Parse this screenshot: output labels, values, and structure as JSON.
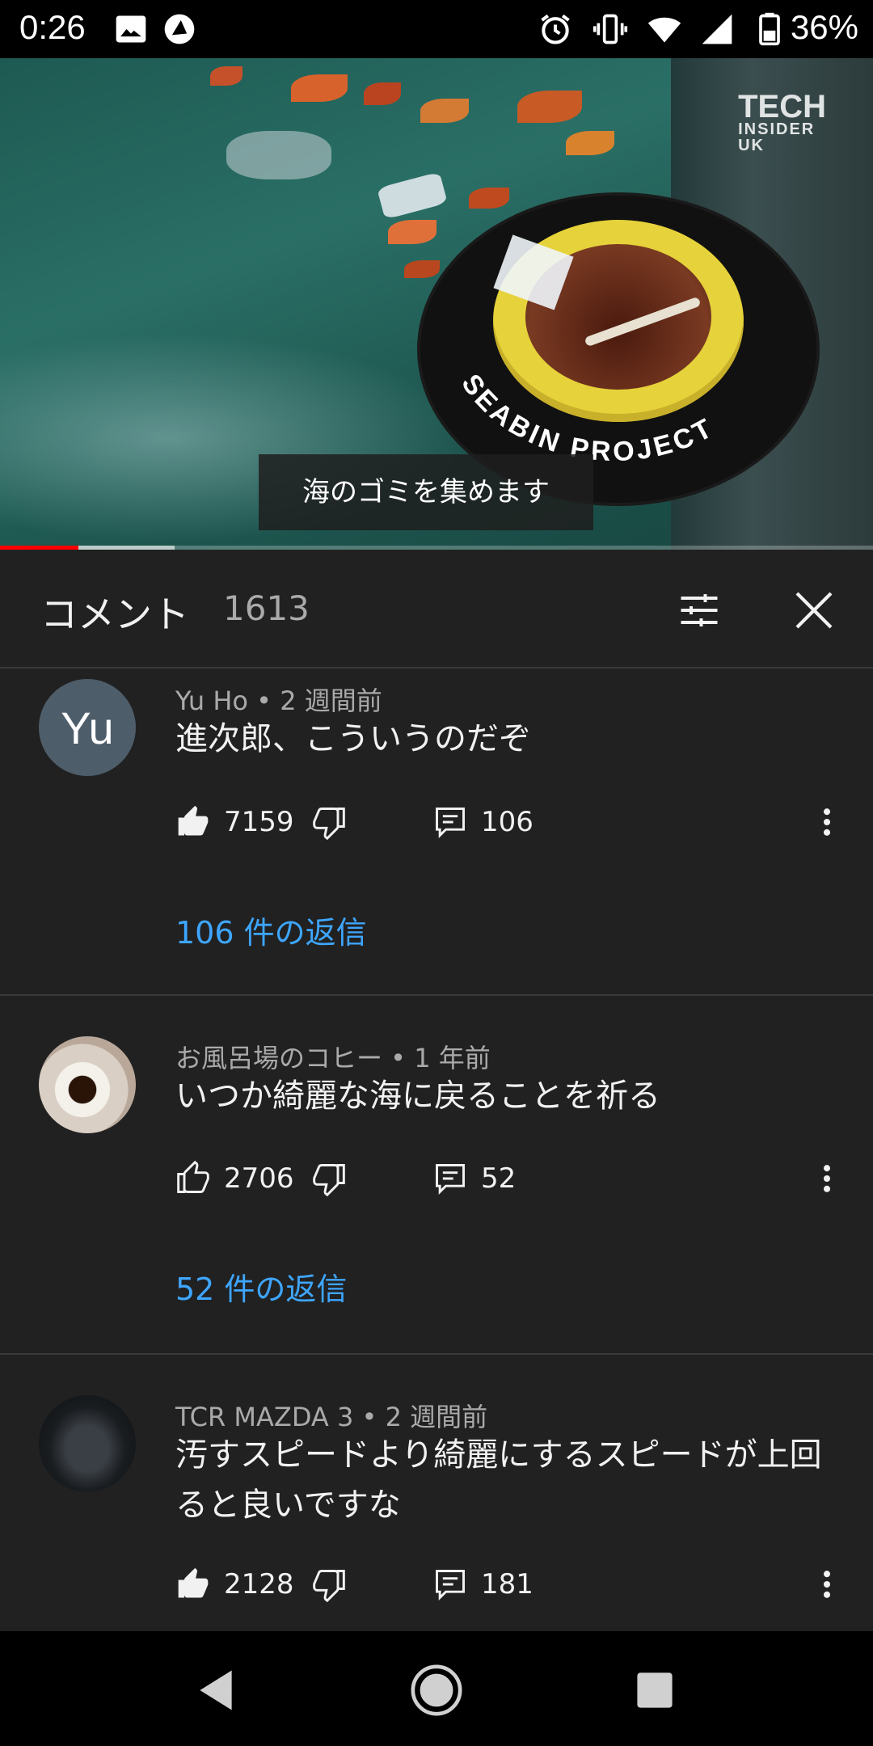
{
  "status_bar": {
    "time": "0:26",
    "battery": "36%"
  },
  "video": {
    "subtitle": "海のゴミを集めます",
    "watermark_line1": "TECH",
    "watermark_line2": "INSIDER",
    "watermark_line3": "UK",
    "bin_text": "SEABIN PROJECT",
    "progress_played_fraction": 0.09,
    "progress_buffered_fraction": 0.2
  },
  "comments_header": {
    "title": "コメント",
    "count": "1613"
  },
  "comments": [
    {
      "avatar_initials": "Yu",
      "author": "Yu Ho",
      "time": "2 週間前",
      "meta": "Yu Ho • 2 週間前",
      "text": "進次郎、こういうのだぞ",
      "likes": "7159",
      "reply_count": "106",
      "replies_link": "106 件の返信",
      "liked": true
    },
    {
      "author": "お風呂場のコヒー",
      "time": "1 年前",
      "meta": "お風呂場のコヒー • 1 年前",
      "text": "いつか綺麗な海に戻ることを祈る",
      "likes": "2706",
      "reply_count": "52",
      "replies_link": "52 件の返信",
      "liked": false
    },
    {
      "author": "TCR MAZDA 3",
      "time": "2 週間前",
      "meta": "TCR MAZDA 3 • 2 週間前",
      "text": "汚すスピードより綺麗にするスピードが上回ると良いですな",
      "likes": "2128",
      "reply_count": "181",
      "liked": true
    }
  ],
  "colors": {
    "background": "#212121",
    "link": "#3ea6ff",
    "progress": "#ff0000"
  }
}
